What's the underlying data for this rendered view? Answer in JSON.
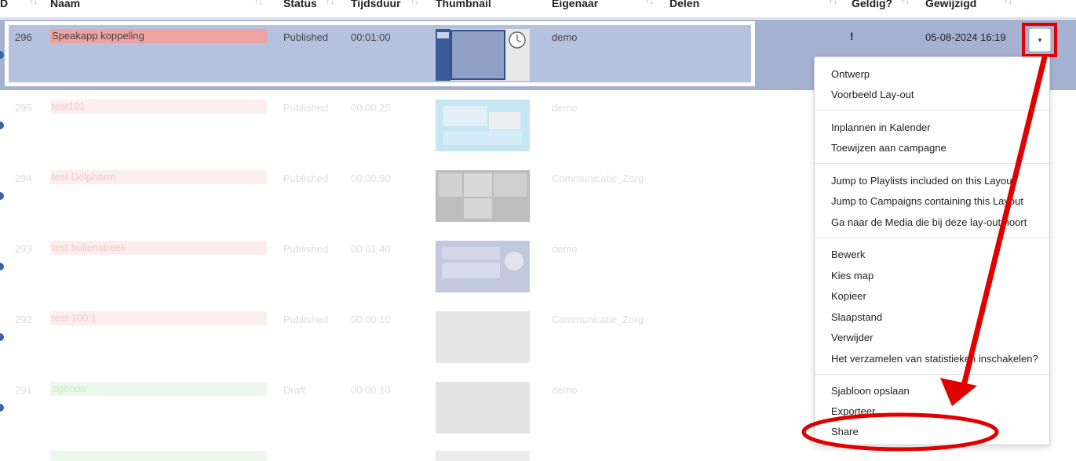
{
  "columns": {
    "id": "D",
    "name": "Naam",
    "status": "Status",
    "duration": "Tijdsduur",
    "thumbnail": "Thumbnail",
    "owner": "Eigenaar",
    "share": "Delen",
    "valid": "Geldig?",
    "modified": "Gewijzigd"
  },
  "sort_icon": "↑↓",
  "rows": [
    {
      "id": "296",
      "name": "Speakapp koppeling",
      "status": "Published",
      "duration": "00:01:00",
      "owner": "demo",
      "valid": "!",
      "modified": "05-08-2024 16:19"
    },
    {
      "id": "295",
      "name": "test101",
      "status": "Published",
      "duration": "00:00:25",
      "owner": "demo"
    },
    {
      "id": "294",
      "name": "test Delpharm",
      "status": "Published",
      "duration": "00:00:50",
      "owner": "Communicatie_Zorg"
    },
    {
      "id": "293",
      "name": "test bollenstreek",
      "status": "Published",
      "duration": "00:01:40",
      "owner": "demo"
    },
    {
      "id": "292",
      "name": "test 100.1",
      "status": "Published",
      "duration": "00:00:10",
      "owner": "Communicatie_Zorg"
    },
    {
      "id": "291",
      "name": "agenda",
      "status": "Draft",
      "duration": "00:00:10",
      "owner": "demo"
    }
  ],
  "menu_button_icon": "caret-down-icon",
  "menu_button_glyph": "▾",
  "dropdown": {
    "design": "Ontwerp",
    "preview": "Voorbeeld Lay-out",
    "schedule": "Inplannen in Kalender",
    "assign_campaign": "Toewijzen aan campagne",
    "jump_playlists": "Jump to Playlists included on this Layout",
    "jump_campaigns": "Jump to Campaigns containing this Layout",
    "goto_media": "Ga naar de Media die bij deze lay-out hoort",
    "edit": "Bewerk",
    "choose_folder": "Kies map",
    "copy": "Kopieer",
    "retire": "Slaapstand",
    "delete": "Verwijder",
    "stats": "Het verzamelen van statistieken inschakelen?",
    "save_template": "Sjabloon opslaan",
    "export": "Exporteer",
    "share": "Share"
  },
  "colors": {
    "annotation_red": "#e00000",
    "selected_row": "#a4b1d0",
    "name_highlight": "#f0a3a3"
  }
}
